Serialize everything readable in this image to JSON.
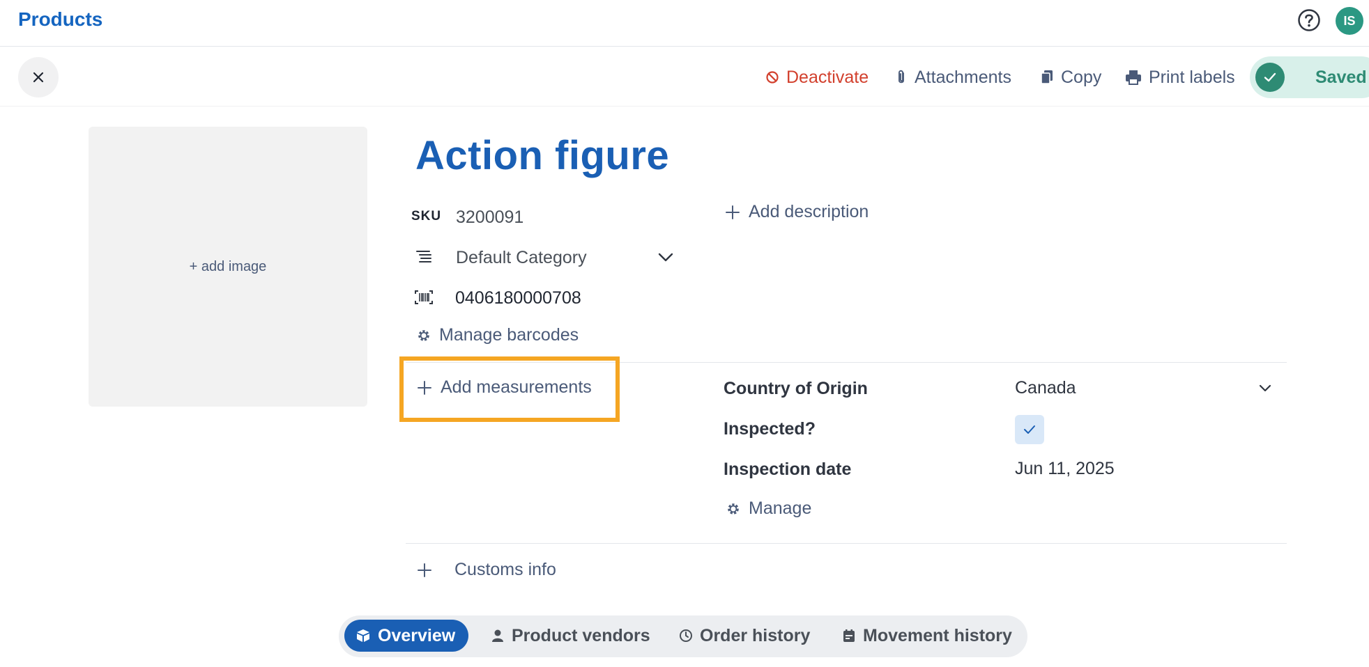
{
  "header": {
    "title": "Products",
    "help_icon": "help-circle-icon",
    "avatar_initials": "IS"
  },
  "toolbar": {
    "close_icon": "close-icon",
    "deactivate_label": "Deactivate",
    "attachments_label": "Attachments",
    "copy_label": "Copy",
    "print_labels_label": "Print labels",
    "saved_label": "Saved"
  },
  "image_area": {
    "add_image_label": "+ add image"
  },
  "product": {
    "name": "Action figure",
    "sku_label": "SKU",
    "sku": "3200091",
    "category": "Default Category",
    "barcode": "0406180000708",
    "manage_barcodes_label": "Manage barcodes",
    "add_description_label": "Add description",
    "add_measurements_label": "Add measurements",
    "customs_info_label": "Customs info"
  },
  "attributes": {
    "country_label": "Country of Origin",
    "country_value": "Canada",
    "inspected_label": "Inspected?",
    "inspected_checked": true,
    "inspection_date_label": "Inspection date",
    "inspection_date_value": "Jun 11, 2025",
    "manage_label": "Manage"
  },
  "tabs": [
    {
      "label": "Overview",
      "icon": "box-icon",
      "active": true
    },
    {
      "label": "Product vendors",
      "icon": "person-icon",
      "active": false
    },
    {
      "label": "Order history",
      "icon": "clock-icon",
      "active": false
    },
    {
      "label": "Movement history",
      "icon": "calendar-icon",
      "active": false
    }
  ],
  "colors": {
    "brand_blue": "#1a5fb4",
    "danger_red": "#d2402d",
    "saved_green": "#2e8b74",
    "highlight_orange": "#f5a623"
  }
}
